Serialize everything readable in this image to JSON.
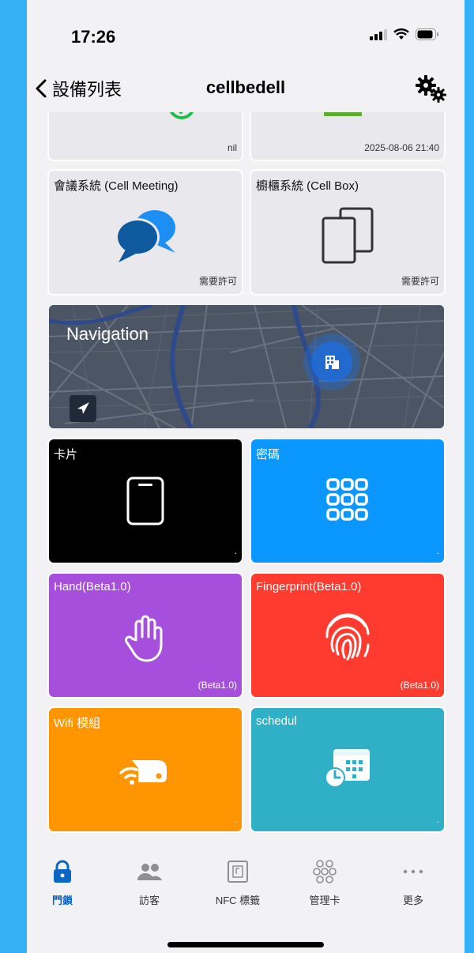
{
  "status": {
    "time": "17:26"
  },
  "nav": {
    "back_label": "設備列表",
    "title": "cellbedell"
  },
  "tiles": {
    "top_left_foot": "nil",
    "top_right_foot": "2025-08-06 21:40",
    "meeting": {
      "title": "會議系統 (Cell Meeting)",
      "foot": "需要許可"
    },
    "box": {
      "title": "櫥櫃系統 (Cell Box)",
      "foot": "需要許可"
    },
    "navigation": {
      "title": "Navigation"
    },
    "card": {
      "title": "卡片",
      "foot": "."
    },
    "password": {
      "title": "密碼",
      "foot": "."
    },
    "hand": {
      "title": "Hand(Beta1.0)",
      "foot": "(Beta1.0)"
    },
    "fingerprint": {
      "title": "Fingerprint(Beta1.0)",
      "foot": "(Beta1.0)"
    },
    "wifi": {
      "title": "Wifi 模組",
      "foot": "."
    },
    "schedule": {
      "title": "schedul",
      "foot": "."
    }
  },
  "tabbar": {
    "items": [
      {
        "label": "門鎖"
      },
      {
        "label": "訪客"
      },
      {
        "label": "NFC 標籤"
      },
      {
        "label": "管理卡"
      },
      {
        "label": "更多"
      }
    ]
  },
  "colors": {
    "card": "#000000",
    "password": "#0a97ff",
    "hand": "#a64fdc",
    "fingerprint": "#ff3b30",
    "wifi": "#ff9500",
    "schedule": "#30b0c7",
    "accent": "#0a66c2"
  }
}
